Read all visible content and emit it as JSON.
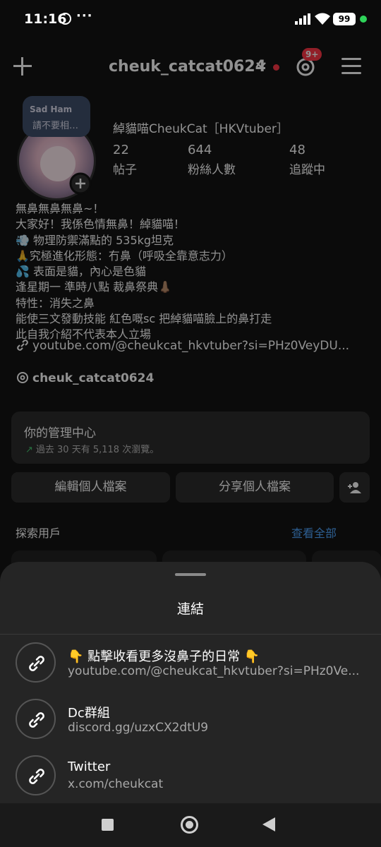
{
  "status_bar": {
    "time": "11:16",
    "extra": "···",
    "battery": "99"
  },
  "top_bar": {
    "username": "cheuk_catcat0624",
    "notification_badge": "9+"
  },
  "profile": {
    "note_song": "Sad Ham",
    "note_text": "請不要相…",
    "display_name": "綽貓喵CheukCat［HKVtuber］",
    "stats": [
      {
        "value": "22",
        "label": "帖子"
      },
      {
        "value": "644",
        "label": "粉絲人數"
      },
      {
        "value": "48",
        "label": "追蹤中"
      }
    ],
    "bio_lines": [
      "無鼻無鼻無鼻~！",
      "大家好！我係色情無鼻！綽貓喵！",
      "💨 物理防禦滿點的 535kg坦克",
      "🙏究極進化形態：冇鼻（呼吸全靠意志力）",
      "💦 表面是貓，內心是色貓",
      "逢星期一 準時八點 裁鼻祭典👃🏽",
      "特性：消失之鼻",
      "能使三文發動技能 紅色嘅sc 把綽貓喵臉上的鼻打走",
      "此自我介紹不代表本人立場"
    ],
    "link": "youtube.com/@cheukcat_hkvtuber?si=PHz0VeyDU...",
    "threads_handle": "cheuk_catcat0624"
  },
  "dashboard": {
    "title": "你的管理中心",
    "subtitle": "過去 30 天有 5,118 次瀏覽。"
  },
  "buttons": {
    "edit": "編輯個人檔案",
    "share": "分享個人檔案"
  },
  "explore": {
    "label": "探索用戶",
    "see_all": "查看全部"
  },
  "sheet": {
    "title": "連結",
    "links": [
      {
        "name": "👇 點擊收看更多沒鼻子的日常 👇",
        "url": "youtube.com/@cheukcat_hkvtuber?si=PHz0Ve..."
      },
      {
        "name": "Dc群組",
        "url": "discord.gg/uzxCX2dtU9"
      },
      {
        "name": "Twitter",
        "url": "x.com/cheukcat"
      }
    ]
  },
  "colors": {
    "accent_link": "#4aa3ff",
    "badge_red": "#ff3040",
    "growth_green": "#3fc46a",
    "sheet_bg": "#252525"
  }
}
